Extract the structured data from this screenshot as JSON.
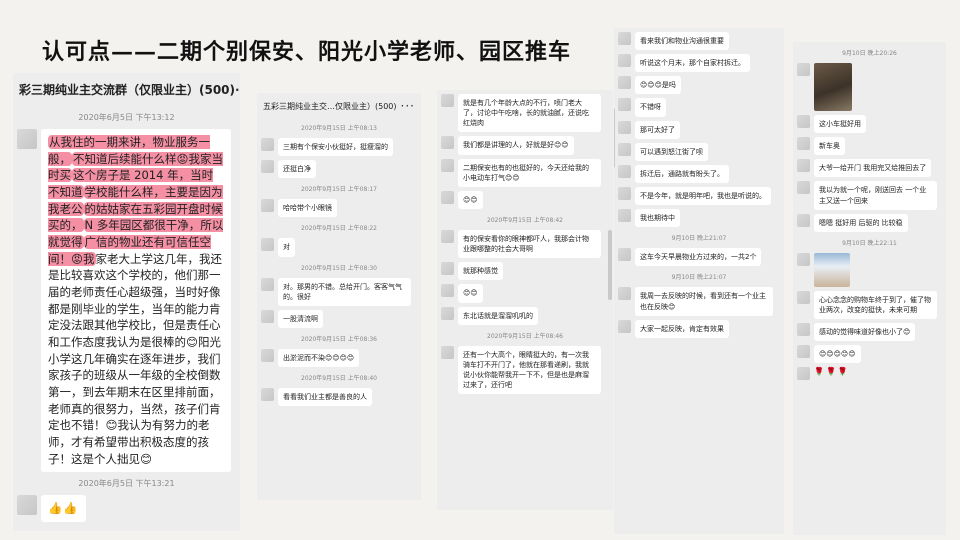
{
  "title": "认可点——二期个别保安、阳光小学老师、园区推车",
  "col1": {
    "header": "彩三期纯业主交流群（仅限业主）(500)",
    "ts1": "2020年6月5日 下午13:12",
    "hl_lines": [
      "从我住的一期来讲，物业服务一般，",
      "不知道后续能什么样😡我家当时买",
      "这个房子是 2014 年，当时不知道",
      "学校能什么样，主要是因为我老公",
      "的姑姑家在五彩园开盘时候买的，",
      "N 多年园区都很干净，所以就觉得",
      "广信的物业还有可信任空间！😡我"
    ],
    "rest": "家老大上学这几年，我还是比较喜欢这个学校的，他们那一届的老师责任心超级强，当时好像都是刚毕业的学生，当年的能力肯定没法跟其他学校比，但是责任心和工作态度我认为是很棒的😊阳光小学这几年确实在逐年进步，我们家孩子的班级从一年级的全校倒数第一，到去年期末在区里排前面，老师真的很努力，当然，孩子们肯定也不错！😊我认为有努力的老师，才有希望带出积极态度的孩子！这是个人拙见😊",
    "ts2": "2020年6月5日 下午13:21",
    "thumbs": "👍👍"
  },
  "col2": {
    "header": "五彩三期纯业主交…仅限业主）(500)",
    "items": [
      {
        "ts": "2020年9月15日 上午08:13",
        "msg": "三期有个保安小伙挺好，挺瘦溜的"
      },
      {
        "ts": "",
        "msg": "还挺白净"
      },
      {
        "ts": "2020年9月15日 上午08:17",
        "msg": "哈哈带个小眼镜"
      },
      {
        "ts": "2020年9月15日 上午08:22",
        "msg": "对"
      },
      {
        "ts": "2020年9月15日 上午08:30",
        "msg": "对。那男的不错。总给开门。客客气气的。很好"
      },
      {
        "ts": "",
        "msg": "一股清流啊"
      },
      {
        "ts": "2020年9月15日 上午08:36",
        "msg": "出淤泥而不染😊😊😊😊"
      },
      {
        "ts": "2020年9月15日 上午08:40",
        "msg": "看看我们业主都是善良的人"
      }
    ]
  },
  "col3": {
    "items": [
      {
        "ts": "",
        "msg": "就是有几个年龄大点的不行，喷门老大了，讨论中午吃啥，长的就油腻，还说吃红烧肉"
      },
      {
        "ts": "",
        "msg": "我们都是讲理的人，好就是好😊😊"
      },
      {
        "ts": "",
        "msg": "二期保安也有的也挺好的，今天还给我的小电动车打气😊😊"
      },
      {
        "ts": "",
        "msg": "😊😊"
      },
      {
        "ts": "2020年9月15日 上午08:42",
        "msg": "有的保安看你的眼神都吓人，我那会计物业跟哪整的社会大哥啊"
      },
      {
        "ts": "",
        "msg": "就那种感觉"
      },
      {
        "ts": "",
        "msg": "😊😊"
      },
      {
        "ts": "",
        "msg": "东北话就是溜溜叽叽的"
      },
      {
        "ts": "2020年9月15日 上午08:46",
        "msg": "还有一个大高个，眼睛挺大的，有一次我骑车打不开门了，他就在那看递刷，我就说小伙你能帮我开一下不，但是也是麻溜过来了，还行吧"
      }
    ]
  },
  "col4": {
    "items": [
      {
        "ts": "",
        "msg": "看来我们和物业沟通很重要"
      },
      {
        "ts": "",
        "msg": "听说这个月末，那个自家村拆迁。"
      },
      {
        "ts": "",
        "msg": "😊😊😊是吗"
      },
      {
        "ts": "",
        "msg": "不错呀"
      },
      {
        "ts": "",
        "msg": "那可太好了"
      },
      {
        "ts": "",
        "msg": "可以遇到怒江街了呗"
      },
      {
        "ts": "",
        "msg": "拆迁后，通路就有盼头了。"
      },
      {
        "ts": "",
        "msg": "不是今年，就是明年吧，我也是听说的。"
      },
      {
        "ts": "",
        "msg": "我也期待中"
      },
      {
        "ts": "9月10日 晚上21:07",
        "msg": "这车今天早晨物业方过来的，一共2个"
      },
      {
        "ts": "9月10日 晚上21:07",
        "msg": "我周一去反映的时候，看到还有一个业主也在反映😊"
      },
      {
        "ts": "",
        "msg": "大家一起反映，肯定有效果"
      }
    ]
  },
  "col5": {
    "ts1": "9月10日 晚上20:26",
    "items": [
      "这小车挺好用",
      "新车奥",
      "大爷一给开门 我用完又给推回去了",
      "我以为就一个呢，刚送回去 一个业主又送一个回来",
      "嗯嗯 挺好用 后驱的 比较稳"
    ],
    "ts2": "9月10日 晚上22:11",
    "items2": [
      "心心念念的购物车终于到了，催了物业两次，改变的挺快，未来可期",
      "感动的觉得味道好像也小了😊",
      "😊😊😊😊😊"
    ],
    "flowers": "🌹🌹🌹"
  }
}
